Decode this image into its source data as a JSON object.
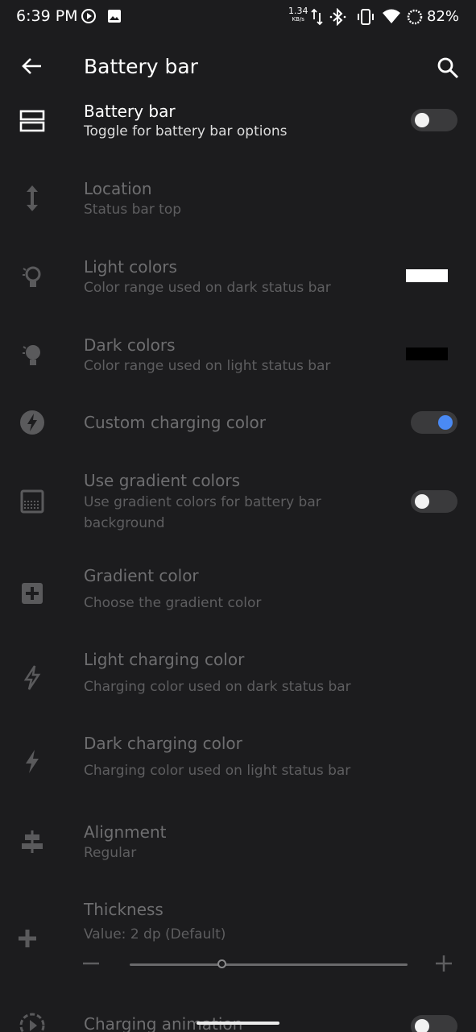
{
  "status_bar": {
    "time": "6:39 PM",
    "net_speed": "1.34",
    "net_unit": "KB/s",
    "battery_percent": "82%",
    "icons": [
      "media-play-icon",
      "image-icon",
      "data-arrows-icon",
      "bluetooth-icon",
      "vibrate-icon",
      "wifi-icon",
      "battery-ring-icon"
    ]
  },
  "app_bar": {
    "title": "Battery bar",
    "back_icon": "arrow-back-icon",
    "search_icon": "search-icon"
  },
  "settings": [
    {
      "icon": "battery-bar-icon",
      "title": "Battery bar",
      "subtitle": "Toggle for battery bar options",
      "control": "toggle",
      "checked": false,
      "enabled": true
    },
    {
      "icon": "vertical-arrows-icon",
      "title": "Location",
      "subtitle": "Status bar top",
      "enabled": false
    },
    {
      "icon": "lightbulb-outline-icon",
      "title": "Light colors",
      "subtitle": "Color range used on dark status bar",
      "control": "swatch",
      "swatch_color": "#ffffff",
      "enabled": false
    },
    {
      "icon": "lightbulb-filled-icon",
      "title": "Dark colors",
      "subtitle": "Color range used on light status bar",
      "control": "swatch",
      "swatch_color": "#000000",
      "enabled": false
    },
    {
      "icon": "bolt-circle-icon",
      "title": "Custom charging color",
      "control": "toggle",
      "checked": true,
      "enabled": false
    },
    {
      "icon": "gradient-icon",
      "title": "Use gradient colors",
      "subtitle": "Use gradient colors for battery bar",
      "subtitle2": "background",
      "control": "toggle",
      "checked": false,
      "enabled": false
    },
    {
      "icon": "add-box-icon",
      "title": "Gradient color",
      "subtitle": "Choose the gradient color",
      "enabled": false
    },
    {
      "icon": "bolt-outline-icon",
      "title": "Light charging color",
      "subtitle": "Charging color used on dark status bar",
      "enabled": false
    },
    {
      "icon": "bolt-filled-icon",
      "title": "Dark charging color",
      "subtitle": "Charging color used on light status bar",
      "enabled": false
    },
    {
      "icon": "align-center-icon",
      "title": "Alignment",
      "subtitle": "Regular",
      "enabled": false
    },
    {
      "icon": "plus-icon",
      "title": "Thickness",
      "subtitle": "Value: 2 dp (Default)",
      "control": "slider",
      "slider_value": 2,
      "enabled": false
    },
    {
      "icon": "play-dashed-circle-icon",
      "title": "Charging animation",
      "control": "toggle",
      "checked": false,
      "enabled": false
    }
  ],
  "colors": {
    "background": "#1c1c1e",
    "accent": "#4a8af4",
    "text_primary": "#ffffff",
    "text_disabled": "#6e6e70"
  }
}
